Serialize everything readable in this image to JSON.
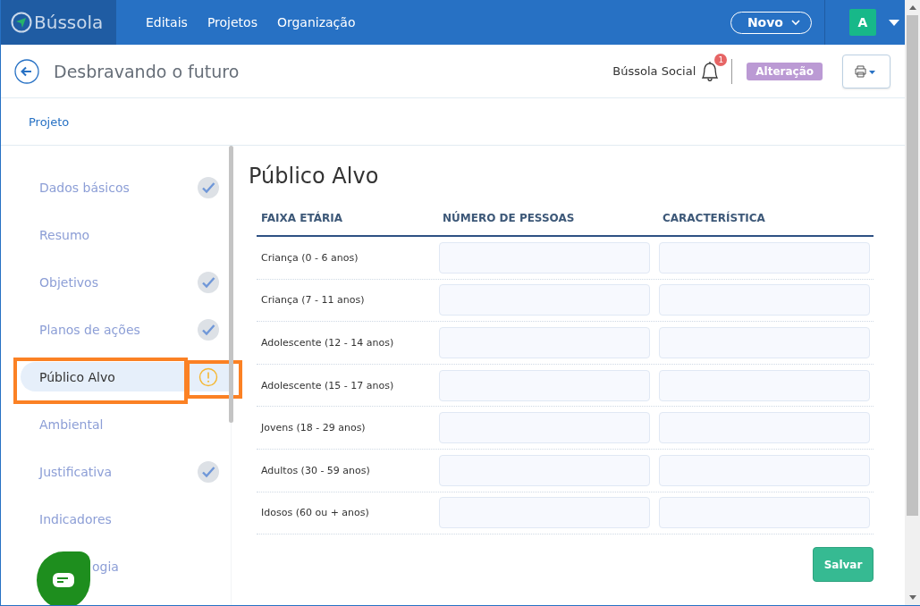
{
  "topbar": {
    "logo": "Bússola",
    "nav": [
      "Editais",
      "Projetos",
      "Organização"
    ],
    "new_button": "Novo",
    "avatar": "A"
  },
  "header": {
    "title": "Desbravando o futuro",
    "organization": "Bússola Social",
    "notification_count": "1",
    "status_badge": "Alteração"
  },
  "tabs": [
    {
      "label": "Projeto",
      "selected": false
    }
  ],
  "sidebar": {
    "items": [
      {
        "label": "Dados básicos",
        "selected": false,
        "completed": true,
        "warning": false,
        "highlighted": false,
        "covered": false
      },
      {
        "label": "Resumo",
        "selected": false,
        "completed": false,
        "warning": false,
        "highlighted": false,
        "covered": false
      },
      {
        "label": "Objetivos",
        "selected": false,
        "completed": true,
        "warning": false,
        "highlighted": false,
        "covered": false
      },
      {
        "label": "Planos de ações",
        "selected": false,
        "completed": true,
        "warning": false,
        "highlighted": false,
        "covered": false
      },
      {
        "label": "Público Alvo",
        "selected": true,
        "completed": false,
        "warning": true,
        "highlighted": true,
        "covered": false
      },
      {
        "label": "Ambiental",
        "selected": false,
        "completed": false,
        "warning": false,
        "highlighted": false,
        "covered": false
      },
      {
        "label": "Justificativa",
        "selected": false,
        "completed": true,
        "warning": false,
        "highlighted": false,
        "covered": false
      },
      {
        "label": "Indicadores",
        "selected": false,
        "completed": false,
        "warning": false,
        "highlighted": false,
        "covered": false
      },
      {
        "label": "ogia",
        "selected": false,
        "completed": false,
        "warning": false,
        "highlighted": false,
        "covered": true
      }
    ]
  },
  "section": {
    "title": "Público Alvo",
    "table": {
      "columns": [
        "FAIXA ETÁRIA",
        "NÚMERO DE PESSOAS",
        "CARACTERÍSTICA"
      ],
      "rows": [
        {
          "age_range": "Criança (0 - 6 anos)"
        },
        {
          "age_range": "Criança (7 - 11 anos)"
        },
        {
          "age_range": "Adolescente (12 - 14 anos)"
        },
        {
          "age_range": "Adolescente (15 - 17 anos)"
        },
        {
          "age_range": "Jovens (18 - 29 anos)"
        },
        {
          "age_range": "Adultos (30 - 59 anos)"
        },
        {
          "age_range": "Idosos (60 ou + anos)"
        }
      ]
    },
    "save_button": "Salvar"
  }
}
